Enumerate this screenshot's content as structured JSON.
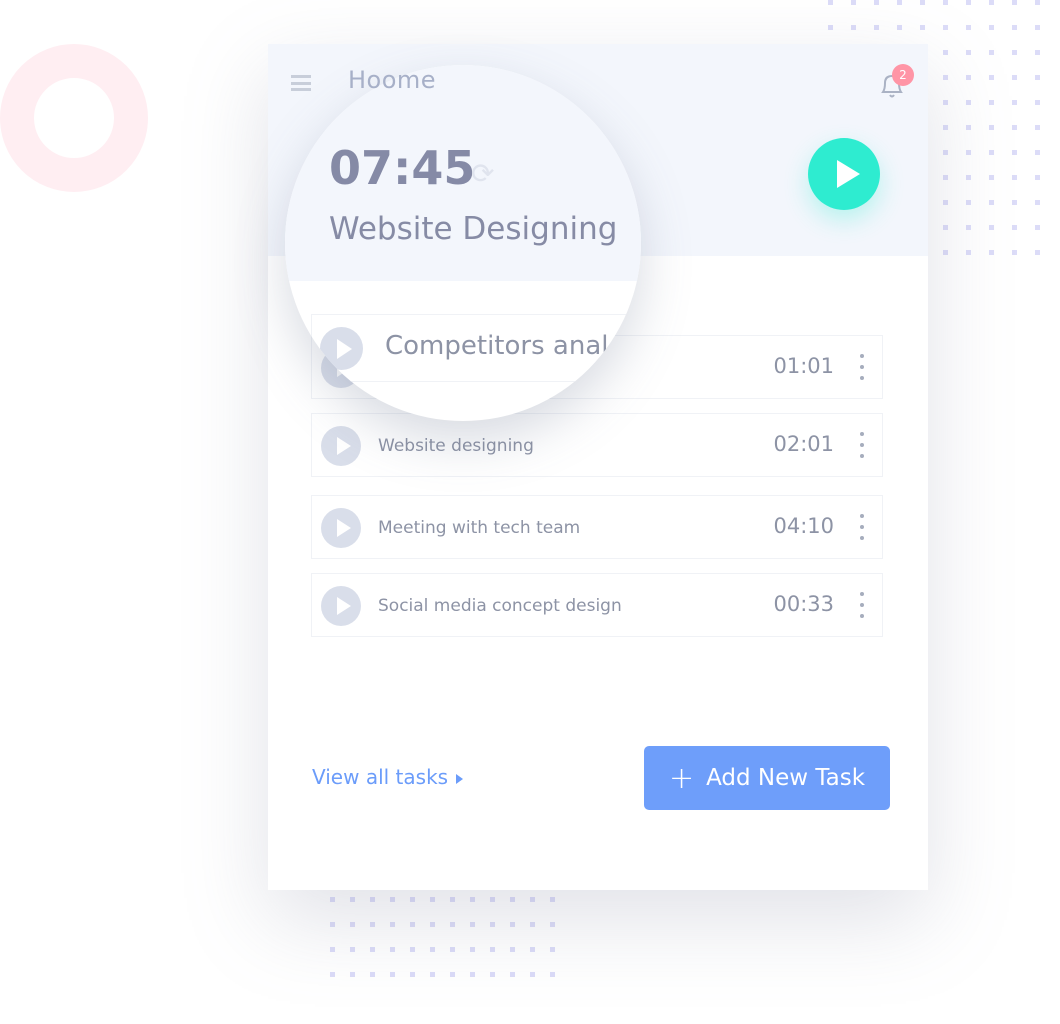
{
  "app": {
    "logo": "Hoome",
    "notification_count": "2"
  },
  "timer": {
    "time": "07:45",
    "task": "Website Designing"
  },
  "magnified_task": {
    "title": "Competitors anal"
  },
  "tasks": [
    {
      "title": "",
      "time": "01:01"
    },
    {
      "title": "Website designing",
      "time": "02:01"
    },
    {
      "title": "Meeting with tech team",
      "time": "04:10"
    },
    {
      "title": "Social media concept design",
      "time": "00:33"
    }
  ],
  "footer": {
    "view_all": "View all tasks",
    "add_task": "Add New Task"
  },
  "colors": {
    "accent": "#6e9efa",
    "play": "#2eecd0",
    "badge": "#ff95a6",
    "header_bg": "#f3f6fc"
  },
  "icons": {
    "menu": "hamburger-icon",
    "bell": "bell-icon",
    "sync": "sync-icon",
    "play": "play-icon",
    "more": "kebab-icon",
    "add": "plus-icon"
  }
}
